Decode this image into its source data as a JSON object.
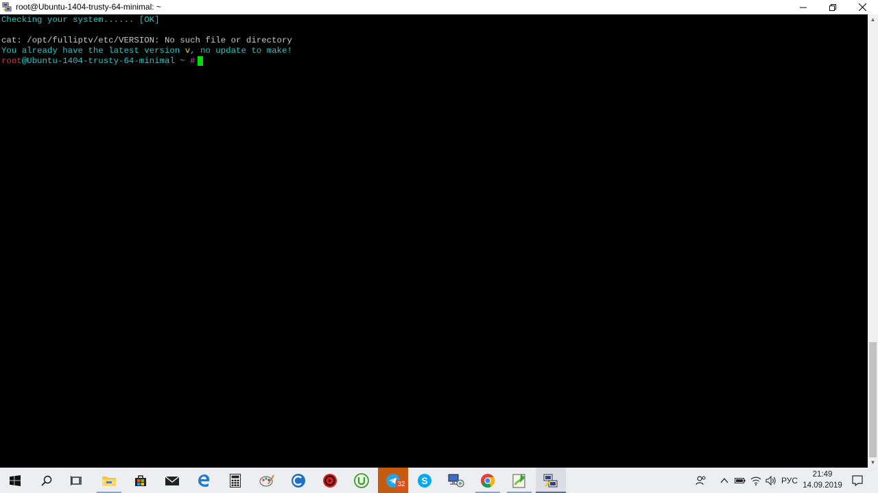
{
  "window": {
    "title": "root@Ubuntu-1404-trusty-64-minimal: ~",
    "controls": [
      "minimize-icon",
      "restore-icon",
      "close-icon"
    ]
  },
  "terminal": {
    "line1": "Checking your system...... [OK]",
    "line2": "cat: /opt/fulliptv/etc/VERSION: No such file or directory",
    "line3a": "You already have the latest version ",
    "line3b": "v",
    "line3c": ", no update to make!",
    "prompt_user": "root",
    "prompt_host": "@Ubuntu-1404-trusty-64-minimal ~ ",
    "prompt_symbol": "#"
  },
  "colors": {
    "cyan": "#21c7c7",
    "red": "#d83b3b",
    "yellow": "#d8d83b",
    "magenta": "#d83bd8",
    "cursor": "#00e000",
    "telegram_active": "#c55a11"
  },
  "taskbar": {
    "apps": [
      "windows-start-icon",
      "search-icon",
      "task-view-icon",
      "file-explorer-icon",
      "store-icon",
      "mail-icon",
      "edge-icon",
      "calculator-icon",
      "paint-icon",
      "ccleaner-icon",
      "red-app-icon",
      "utorrent-icon",
      "telegram-icon",
      "skype-icon",
      "network-computer-icon",
      "chrome-icon",
      "notepad-plus-icon",
      "putty-icon"
    ],
    "telegram_badge": "32",
    "tray": {
      "language": "РУС",
      "time": "21:49",
      "date": "14.09.2019"
    }
  }
}
